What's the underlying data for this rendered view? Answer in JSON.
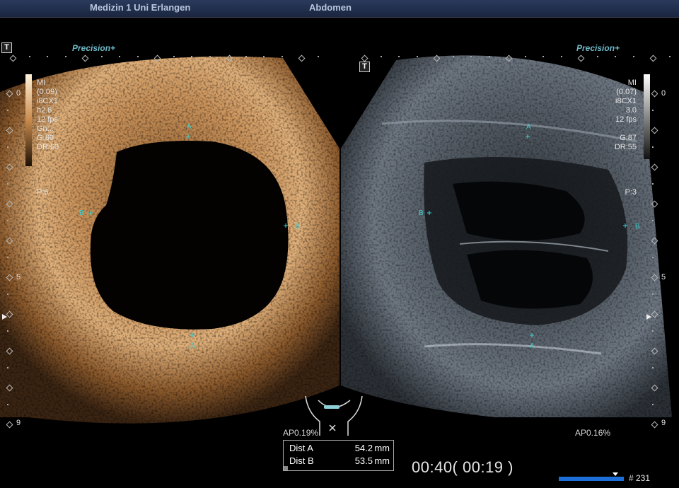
{
  "header": {
    "institution": "Medizin 1 Uni Erlangen",
    "exam": "Abdomen"
  },
  "left_panel": {
    "precision": "Precision+",
    "info": [
      "MI",
      "(0.09)",
      "i8CX1",
      "h2.8",
      "12 fps",
      "Gn:..",
      "G:80",
      "DR:60"
    ],
    "persist": "P:6",
    "ap": "AP0.19%",
    "colormap": "amber"
  },
  "right_panel": {
    "precision": "Precision+",
    "info": [
      "MI",
      "(0.07)",
      "i8CX1",
      "3.0",
      "12 fps",
      "",
      "G:87",
      "DR:55"
    ],
    "persist": "P:3",
    "ap": "AP0.16%",
    "colormap": "gray"
  },
  "depth_scale": {
    "top": "0",
    "mid": "5",
    "bottom": "9"
  },
  "calipers": {
    "a": "A",
    "b": "B"
  },
  "measurements": [
    {
      "label": "Dist A",
      "value": "54.2",
      "unit": "mm"
    },
    {
      "label": "Dist B",
      "value": "53.5",
      "unit": "mm"
    }
  ],
  "timer": "00:40( 00:19 )",
  "frame_counter": "# 231",
  "colors": {
    "header_bg": "#1a2540",
    "caliper": "#3fd0d0",
    "progress": "#1c6fd8",
    "precision": "#6fb9c8"
  },
  "icons": [
    "transducer-mark-icon",
    "orientation-triangle-icon",
    "probe-position-icon",
    "close-icon"
  ]
}
